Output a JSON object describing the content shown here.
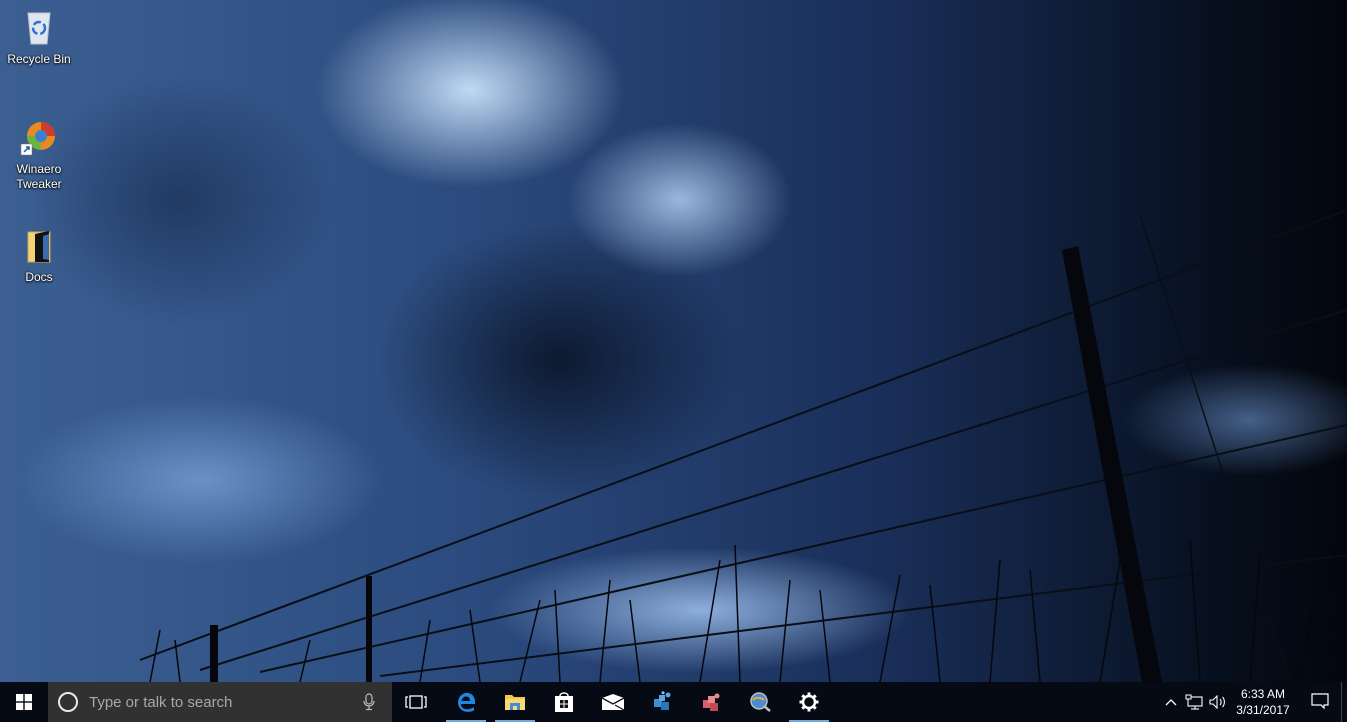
{
  "desktop": {
    "icons": [
      {
        "label": "Recycle Bin",
        "icon": "recycle-bin-icon"
      },
      {
        "label": "Winaero Tweaker",
        "label_line1": "Winaero",
        "label_line2": "Tweaker",
        "icon": "winaero-tweaker-icon",
        "shortcut": true
      },
      {
        "label": "Docs",
        "icon": "folder-icon"
      }
    ]
  },
  "taskbar": {
    "start_icon": "windows-logo-icon",
    "search": {
      "placeholder": "Type or talk to search",
      "cortana_icon": "cortana-circle-icon",
      "mic_icon": "microphone-icon"
    },
    "task_view_icon": "task-view-icon",
    "pinned": [
      {
        "name": "Microsoft Edge",
        "icon": "edge-icon",
        "running": true
      },
      {
        "name": "File Explorer",
        "icon": "file-explorer-icon",
        "running": true
      },
      {
        "name": "Store",
        "icon": "store-icon",
        "running": false
      },
      {
        "name": "Mail",
        "icon": "mail-icon",
        "running": false
      },
      {
        "name": "App (blue cubes)",
        "icon": "blue-cubes-icon",
        "running": false
      },
      {
        "name": "App (red cubes)",
        "icon": "red-cubes-icon",
        "running": false
      },
      {
        "name": "App (magnifier globe)",
        "icon": "globe-search-icon",
        "running": false
      },
      {
        "name": "Settings",
        "icon": "gear-icon",
        "running": true
      }
    ],
    "tray": {
      "chevron_icon": "chevron-up-icon",
      "network_icon": "network-icon",
      "volume_icon": "volume-icon",
      "time": "6:33 AM",
      "date": "3/31/2017",
      "action_center_icon": "action-center-icon"
    },
    "accent_color": "#76a8d6"
  }
}
